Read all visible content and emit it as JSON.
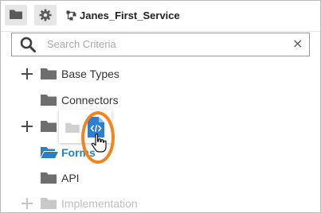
{
  "toolbar": {
    "service_name": "Janes_First_Service",
    "icons": [
      "folder-icon",
      "gear-icon",
      "service-icon"
    ]
  },
  "search": {
    "placeholder": "Search Criteria",
    "value": "",
    "clear_glyph": "×"
  },
  "tree": {
    "items": [
      {
        "label": "Base Types",
        "expandable": true
      },
      {
        "label": "Connectors",
        "expandable": false
      },
      {
        "label": "",
        "expandable": true
      },
      {
        "label": "Forms",
        "expandable": false,
        "selected": true
      },
      {
        "label": "API",
        "expandable": false
      },
      {
        "label": "Implementation",
        "expandable": true
      }
    ]
  },
  "drag_ghost": {
    "icon": "code-file-icon",
    "cursor": "hand-pointer-cursor"
  },
  "colors": {
    "accent_blue": "#2a7fc0",
    "highlight_orange": "#f2841b",
    "folder_gray": "#6e6e6e",
    "file_blue": "#2f7fd0"
  }
}
